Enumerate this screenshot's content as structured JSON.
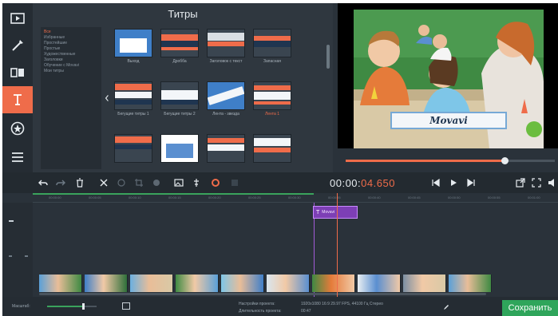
{
  "window": {
    "panel_title": "Титры",
    "timecode_main": "00:00:",
    "timecode_ms": "04.650"
  },
  "toolstrip": {
    "items": [
      {
        "name": "import-icon"
      },
      {
        "name": "wand-icon"
      },
      {
        "name": "transitions-icon"
      },
      {
        "name": "titles-icon",
        "active": true
      },
      {
        "name": "stickers-icon"
      },
      {
        "name": "more-icon"
      }
    ]
  },
  "categories": [
    {
      "label": "Все",
      "active": true
    },
    {
      "label": "Избранные"
    },
    {
      "label": "Простейшие"
    },
    {
      "label": "Простые"
    },
    {
      "label": "Художественные"
    },
    {
      "label": "Заголовки"
    },
    {
      "label": "Обучение с Movavi"
    },
    {
      "label": "Мои титры"
    }
  ],
  "tiles": [
    {
      "label": "Выход",
      "style": "text"
    },
    {
      "label": "Дробба",
      "style": "banner"
    },
    {
      "label": "Заголовок с текст",
      "style": "banner2"
    },
    {
      "label": "Запасная",
      "style": "banner3"
    },
    {
      "label": "Бегущие титры 1",
      "style": "banner4"
    },
    {
      "label": "Бегущие титры 2",
      "style": "banner5"
    },
    {
      "label": "Лента - звезда",
      "style": "ribbon"
    },
    {
      "label": "Лента 1",
      "style": "banner6",
      "active": true
    },
    {
      "label": "",
      "style": "banner7"
    },
    {
      "label": "",
      "style": "textlight"
    },
    {
      "label": "",
      "style": "banner8"
    },
    {
      "label": "",
      "style": "banner9"
    }
  ],
  "preview": {
    "banner_text": "Movavi",
    "progress": 0.76
  },
  "ruler_ticks": [
    "00:00:00",
    "00:00:05",
    "00:00:10",
    "00:00:15",
    "00:00:20",
    "00:00:25",
    "00:00:30",
    "00:00:35",
    "00:00:40",
    "00:00:45",
    "00:00:50",
    "00:00:55",
    "00:01:00"
  ],
  "timeline": {
    "title_clip": "Movavi",
    "clip_count": 10
  },
  "status": {
    "scale_label": "Масштаб:",
    "project_settings_label": "Настройки проекта:",
    "project_settings_value": "1920x1080 16:9 29.97 FPS, 44100 Гц Стерео",
    "duration_label": "Длительность проекта:",
    "duration_value": "00:47",
    "save_label": "Сохранить",
    "zoom_level": 0.72
  },
  "colors": {
    "accent": "#ef6c4a",
    "save": "#2fa55b",
    "title_clip": "#7d3fb5"
  }
}
